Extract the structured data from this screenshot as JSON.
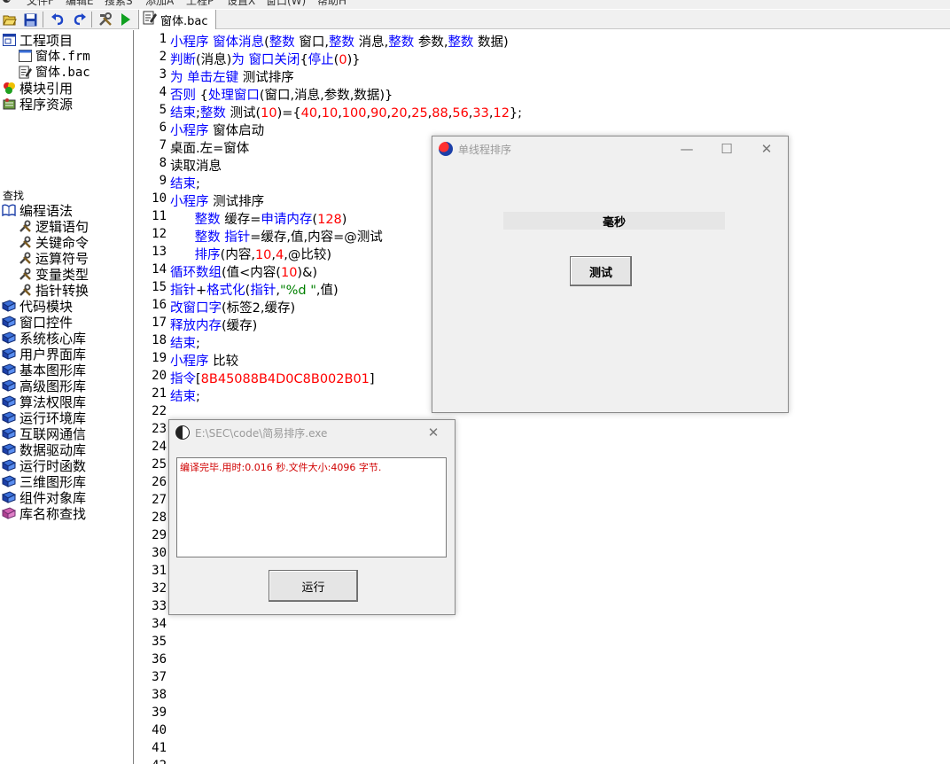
{
  "menu": [
    "文件F",
    "编辑E",
    "搜索S",
    "添加A",
    "工程P",
    "设置X",
    "窗口(W)",
    "帮助H"
  ],
  "toolbar": {
    "icons": [
      "open-folder-icon",
      "save-icon",
      "undo-icon",
      "redo-icon",
      "tools-icon",
      "run-icon"
    ],
    "tab_label": "窗体.bac"
  },
  "tree": {
    "project": "工程项目",
    "frm": "窗体.frm",
    "bac": "窗体.bac",
    "module_ref": "模块引用",
    "resources": "程序资源",
    "find": "查找",
    "syntax": "编程语法",
    "syntax_children": [
      "逻辑语句",
      "关键命令",
      "运算符号",
      "变量类型",
      "指针转换"
    ],
    "libraries": [
      "代码模块",
      "窗口控件",
      "系统核心库",
      "用户界面库",
      "基本图形库",
      "高级图形库",
      "算法权限库",
      "运行环境库",
      "互联网通信",
      "数据驱动库",
      "运行时函数",
      "三维图形库",
      "组件对象库"
    ],
    "lib_search": "库名称查找"
  },
  "editor": {
    "line_count": 42,
    "lines": [
      [
        [
          "kw",
          "小程序"
        ],
        [
          "t",
          " "
        ],
        [
          "kw",
          "窗体消息"
        ],
        [
          "t",
          "("
        ],
        [
          "kw",
          "整数"
        ],
        [
          "t",
          " 窗口,"
        ],
        [
          "kw",
          "整数"
        ],
        [
          "t",
          " 消息,"
        ],
        [
          "kw",
          "整数"
        ],
        [
          "t",
          " 参数,"
        ],
        [
          "kw",
          "整数"
        ],
        [
          "t",
          " 数据)"
        ]
      ],
      [
        [
          "kw",
          "判断"
        ],
        [
          "t",
          "(消息)"
        ],
        [
          "kw",
          "为"
        ],
        [
          "t",
          " "
        ],
        [
          "kw",
          "窗口关闭"
        ],
        [
          "t",
          "{"
        ],
        [
          "kw",
          "停止"
        ],
        [
          "t",
          "("
        ],
        [
          "num",
          "0"
        ],
        [
          "t",
          ")}"
        ]
      ],
      [
        [
          "kw",
          "为"
        ],
        [
          "t",
          " "
        ],
        [
          "kw",
          "单击左键"
        ],
        [
          "t",
          " 测试排序"
        ]
      ],
      [
        [
          "kw",
          "否则"
        ],
        [
          "t",
          " {"
        ],
        [
          "kw",
          "处理窗口"
        ],
        [
          "t",
          "(窗口,消息,参数,数据)}"
        ]
      ],
      [
        [
          "kw",
          "结束"
        ],
        [
          "t",
          ";"
        ],
        [
          "kw",
          "整数"
        ],
        [
          "t",
          " 测试("
        ],
        [
          "num",
          "10"
        ],
        [
          "t",
          ")={"
        ],
        [
          "num",
          "40"
        ],
        [
          "t",
          ","
        ],
        [
          "num",
          "10"
        ],
        [
          "t",
          ","
        ],
        [
          "num",
          "100"
        ],
        [
          "t",
          ","
        ],
        [
          "num",
          "90"
        ],
        [
          "t",
          ","
        ],
        [
          "num",
          "20"
        ],
        [
          "t",
          ","
        ],
        [
          "num",
          "25"
        ],
        [
          "t",
          ","
        ],
        [
          "num",
          "88"
        ],
        [
          "t",
          ","
        ],
        [
          "num",
          "56"
        ],
        [
          "t",
          ","
        ],
        [
          "num",
          "33"
        ],
        [
          "t",
          ","
        ],
        [
          "num",
          "12"
        ],
        [
          "t",
          "};"
        ]
      ],
      [
        [
          "kw",
          "小程序"
        ],
        [
          "t",
          " 窗体启动"
        ]
      ],
      [
        [
          "t",
          "桌面.左=窗体"
        ]
      ],
      [
        [
          "t",
          "读取消息"
        ]
      ],
      [
        [
          "kw",
          "结束"
        ],
        [
          "t",
          ";"
        ]
      ],
      [
        [
          "kw",
          "小程序"
        ],
        [
          "t",
          " 测试排序"
        ]
      ],
      [
        [
          "t",
          "      "
        ],
        [
          "kw",
          "整数"
        ],
        [
          "t",
          " 缓存="
        ],
        [
          "kw",
          "申请内存"
        ],
        [
          "t",
          "("
        ],
        [
          "num",
          "128"
        ],
        [
          "t",
          ")"
        ]
      ],
      [
        [
          "t",
          "      "
        ],
        [
          "kw",
          "整数"
        ],
        [
          "t",
          " "
        ],
        [
          "kw",
          "指针"
        ],
        [
          "t",
          "=缓存,值,内容=@测试"
        ]
      ],
      [
        [
          "t",
          "      "
        ],
        [
          "kw",
          "排序"
        ],
        [
          "t",
          "(内容,"
        ],
        [
          "num",
          "10"
        ],
        [
          "t",
          ","
        ],
        [
          "num",
          "4"
        ],
        [
          "t",
          ",@比较)"
        ]
      ],
      [
        [
          "kw",
          "循环数组"
        ],
        [
          "t",
          "(值<内容("
        ],
        [
          "num",
          "10"
        ],
        [
          "t",
          ")&)"
        ]
      ],
      [
        [
          "kw",
          "指针"
        ],
        [
          "t",
          "+"
        ],
        [
          "kw",
          "格式化"
        ],
        [
          "t",
          "("
        ],
        [
          "kw",
          "指针"
        ],
        [
          "t",
          ","
        ],
        [
          "str",
          "\"%d \""
        ],
        [
          "t",
          ",值)"
        ]
      ],
      [
        [
          "kw",
          "改窗口字"
        ],
        [
          "t",
          "(标签2,缓存)"
        ]
      ],
      [
        [
          "kw",
          "释放内存"
        ],
        [
          "t",
          "(缓存)"
        ]
      ],
      [
        [
          "kw",
          "结束"
        ],
        [
          "t",
          ";"
        ]
      ],
      [
        [
          "kw",
          "小程序"
        ],
        [
          "t",
          " 比较"
        ]
      ],
      [
        [
          "kw",
          "指令"
        ],
        [
          "t",
          "["
        ],
        [
          "num",
          "8B45088B4D0C8B002B01"
        ],
        [
          "t",
          "]"
        ]
      ],
      [
        [
          "kw",
          "结束"
        ],
        [
          "t",
          ";"
        ]
      ]
    ]
  },
  "sort_window": {
    "title": "单线程排序",
    "label": "毫秒",
    "button": "测试"
  },
  "compile_window": {
    "title": "E:\\SEC\\code\\简易排序.exe",
    "message": "编译完毕.用时:0.016 秒.文件大小:4096 字节.",
    "button": "运行"
  }
}
